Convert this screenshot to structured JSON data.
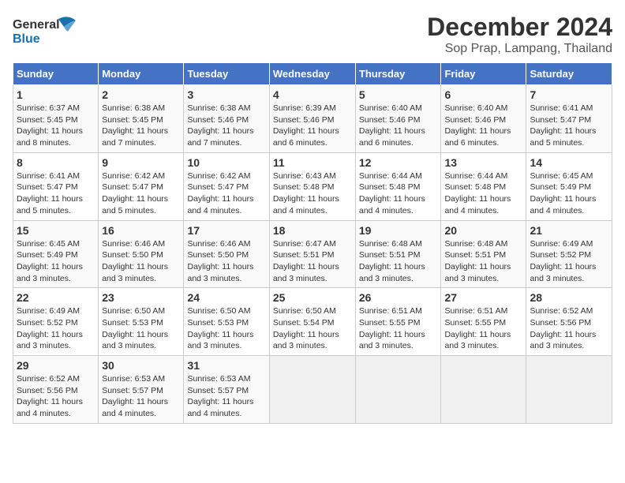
{
  "header": {
    "logo_general": "General",
    "logo_blue": "Blue",
    "main_title": "December 2024",
    "sub_title": "Sop Prap, Lampang, Thailand"
  },
  "columns": [
    "Sunday",
    "Monday",
    "Tuesday",
    "Wednesday",
    "Thursday",
    "Friday",
    "Saturday"
  ],
  "weeks": [
    [
      {
        "day": "1",
        "sunrise": "6:37 AM",
        "sunset": "5:45 PM",
        "daylight": "11 hours and 8 minutes."
      },
      {
        "day": "2",
        "sunrise": "6:38 AM",
        "sunset": "5:45 PM",
        "daylight": "11 hours and 7 minutes."
      },
      {
        "day": "3",
        "sunrise": "6:38 AM",
        "sunset": "5:46 PM",
        "daylight": "11 hours and 7 minutes."
      },
      {
        "day": "4",
        "sunrise": "6:39 AM",
        "sunset": "5:46 PM",
        "daylight": "11 hours and 6 minutes."
      },
      {
        "day": "5",
        "sunrise": "6:40 AM",
        "sunset": "5:46 PM",
        "daylight": "11 hours and 6 minutes."
      },
      {
        "day": "6",
        "sunrise": "6:40 AM",
        "sunset": "5:46 PM",
        "daylight": "11 hours and 6 minutes."
      },
      {
        "day": "7",
        "sunrise": "6:41 AM",
        "sunset": "5:47 PM",
        "daylight": "11 hours and 5 minutes."
      }
    ],
    [
      {
        "day": "8",
        "sunrise": "6:41 AM",
        "sunset": "5:47 PM",
        "daylight": "11 hours and 5 minutes."
      },
      {
        "day": "9",
        "sunrise": "6:42 AM",
        "sunset": "5:47 PM",
        "daylight": "11 hours and 5 minutes."
      },
      {
        "day": "10",
        "sunrise": "6:42 AM",
        "sunset": "5:47 PM",
        "daylight": "11 hours and 4 minutes."
      },
      {
        "day": "11",
        "sunrise": "6:43 AM",
        "sunset": "5:48 PM",
        "daylight": "11 hours and 4 minutes."
      },
      {
        "day": "12",
        "sunrise": "6:44 AM",
        "sunset": "5:48 PM",
        "daylight": "11 hours and 4 minutes."
      },
      {
        "day": "13",
        "sunrise": "6:44 AM",
        "sunset": "5:48 PM",
        "daylight": "11 hours and 4 minutes."
      },
      {
        "day": "14",
        "sunrise": "6:45 AM",
        "sunset": "5:49 PM",
        "daylight": "11 hours and 4 minutes."
      }
    ],
    [
      {
        "day": "15",
        "sunrise": "6:45 AM",
        "sunset": "5:49 PM",
        "daylight": "11 hours and 3 minutes."
      },
      {
        "day": "16",
        "sunrise": "6:46 AM",
        "sunset": "5:50 PM",
        "daylight": "11 hours and 3 minutes."
      },
      {
        "day": "17",
        "sunrise": "6:46 AM",
        "sunset": "5:50 PM",
        "daylight": "11 hours and 3 minutes."
      },
      {
        "day": "18",
        "sunrise": "6:47 AM",
        "sunset": "5:51 PM",
        "daylight": "11 hours and 3 minutes."
      },
      {
        "day": "19",
        "sunrise": "6:48 AM",
        "sunset": "5:51 PM",
        "daylight": "11 hours and 3 minutes."
      },
      {
        "day": "20",
        "sunrise": "6:48 AM",
        "sunset": "5:51 PM",
        "daylight": "11 hours and 3 minutes."
      },
      {
        "day": "21",
        "sunrise": "6:49 AM",
        "sunset": "5:52 PM",
        "daylight": "11 hours and 3 minutes."
      }
    ],
    [
      {
        "day": "22",
        "sunrise": "6:49 AM",
        "sunset": "5:52 PM",
        "daylight": "11 hours and 3 minutes."
      },
      {
        "day": "23",
        "sunrise": "6:50 AM",
        "sunset": "5:53 PM",
        "daylight": "11 hours and 3 minutes."
      },
      {
        "day": "24",
        "sunrise": "6:50 AM",
        "sunset": "5:53 PM",
        "daylight": "11 hours and 3 minutes."
      },
      {
        "day": "25",
        "sunrise": "6:50 AM",
        "sunset": "5:54 PM",
        "daylight": "11 hours and 3 minutes."
      },
      {
        "day": "26",
        "sunrise": "6:51 AM",
        "sunset": "5:55 PM",
        "daylight": "11 hours and 3 minutes."
      },
      {
        "day": "27",
        "sunrise": "6:51 AM",
        "sunset": "5:55 PM",
        "daylight": "11 hours and 3 minutes."
      },
      {
        "day": "28",
        "sunrise": "6:52 AM",
        "sunset": "5:56 PM",
        "daylight": "11 hours and 3 minutes."
      }
    ],
    [
      {
        "day": "29",
        "sunrise": "6:52 AM",
        "sunset": "5:56 PM",
        "daylight": "11 hours and 4 minutes."
      },
      {
        "day": "30",
        "sunrise": "6:53 AM",
        "sunset": "5:57 PM",
        "daylight": "11 hours and 4 minutes."
      },
      {
        "day": "31",
        "sunrise": "6:53 AM",
        "sunset": "5:57 PM",
        "daylight": "11 hours and 4 minutes."
      },
      null,
      null,
      null,
      null
    ]
  ],
  "labels": {
    "sunrise": "Sunrise:",
    "sunset": "Sunset:",
    "daylight": "Daylight:"
  }
}
